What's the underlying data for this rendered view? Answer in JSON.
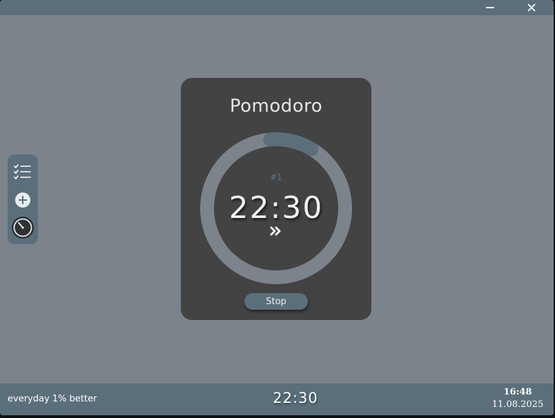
{
  "titlebar": {
    "minimize_icon": "minimize-icon",
    "close_icon": "close-icon"
  },
  "sidebar": {
    "items": [
      {
        "icon": "checklist-icon"
      },
      {
        "icon": "plus-circle-icon"
      },
      {
        "icon": "timer-icon"
      }
    ]
  },
  "card": {
    "title": "Pomodoro",
    "session_label": "#1",
    "time_remaining": "22:30",
    "progress_fraction": 0.1,
    "skip_icon": "fast-forward-icon",
    "stop_label": "Stop"
  },
  "statusbar": {
    "motto": "everyday 1% better",
    "timer": "22:30",
    "clock_time": "16:48",
    "clock_date": "11.08.2025"
  },
  "colors": {
    "window_bg": "#7c838b",
    "bar_bg": "#5b6f7b",
    "card_bg": "#444343",
    "ring_track": "#7c838b",
    "ring_progress": "#5b6f7b"
  }
}
